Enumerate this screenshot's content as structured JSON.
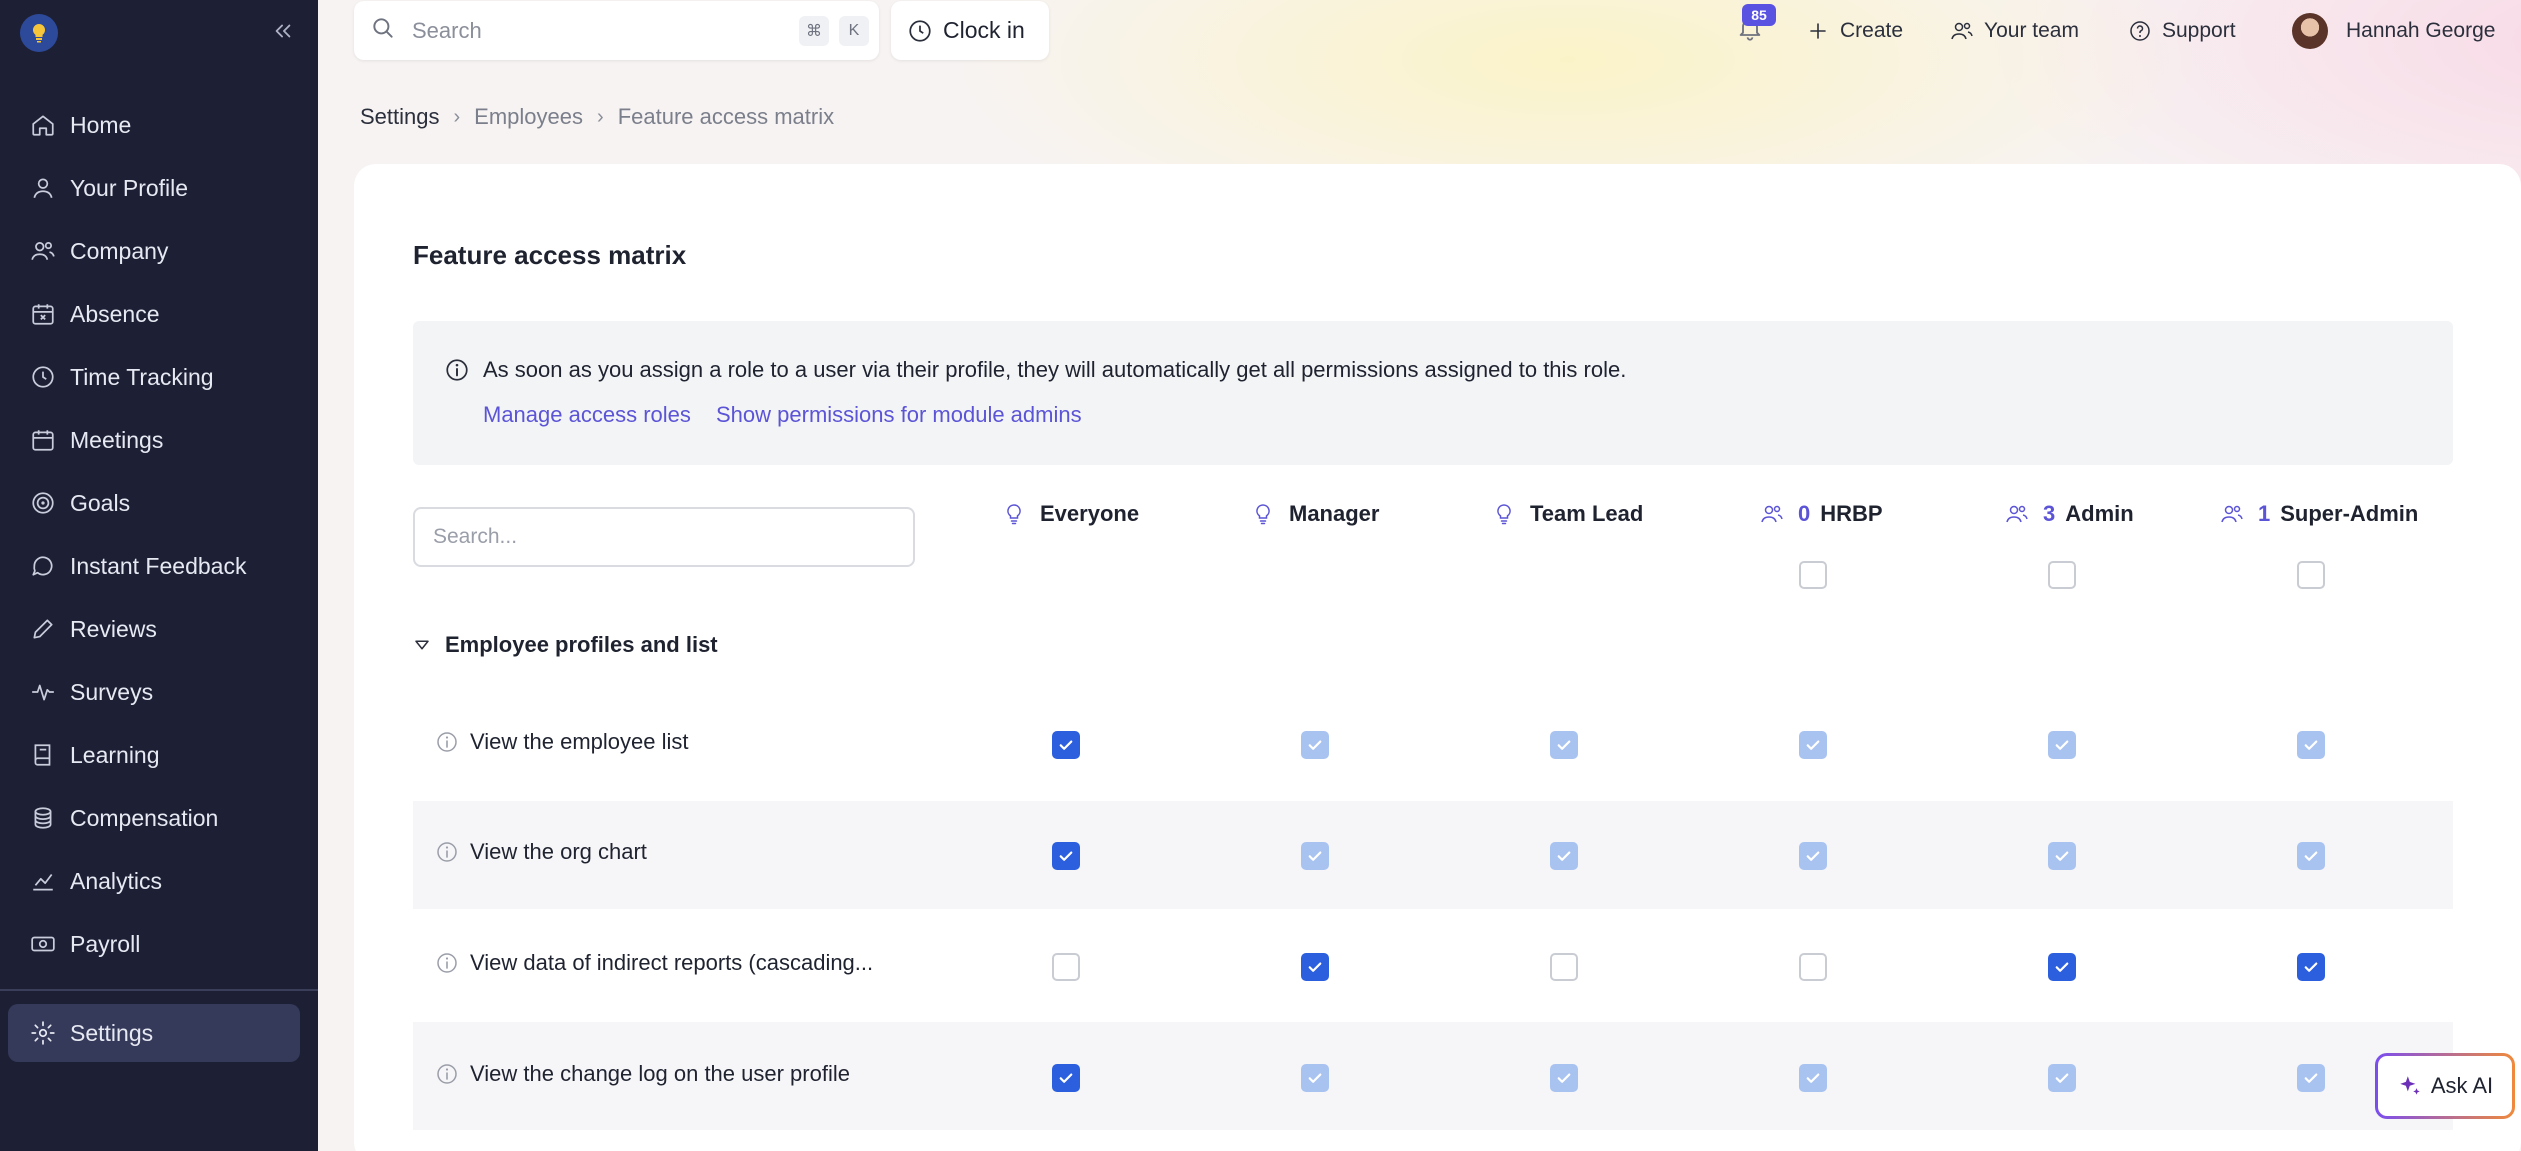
{
  "sidebar": {
    "items": [
      {
        "label": "Home",
        "icon": "home-icon"
      },
      {
        "label": "Your Profile",
        "icon": "user-icon"
      },
      {
        "label": "Company",
        "icon": "people-icon"
      },
      {
        "label": "Absence",
        "icon": "calendar-x-icon"
      },
      {
        "label": "Time Tracking",
        "icon": "clock-icon"
      },
      {
        "label": "Meetings",
        "icon": "calendar-icon"
      },
      {
        "label": "Goals",
        "icon": "target-icon"
      },
      {
        "label": "Instant Feedback",
        "icon": "chat-bubble-icon"
      },
      {
        "label": "Reviews",
        "icon": "pencil-icon"
      },
      {
        "label": "Surveys",
        "icon": "pulse-icon"
      },
      {
        "label": "Learning",
        "icon": "book-icon"
      },
      {
        "label": "Compensation",
        "icon": "coins-icon"
      },
      {
        "label": "Analytics",
        "icon": "chart-icon"
      },
      {
        "label": "Payroll",
        "icon": "banknote-icon"
      }
    ],
    "settings_label": "Settings"
  },
  "topbar": {
    "search_placeholder": "Search",
    "kbd_cmd": "⌘",
    "kbd_k": "K",
    "clock_in_label": "Clock in",
    "notification_count": "85",
    "create_label": "Create",
    "team_label": "Your team",
    "support_label": "Support",
    "user_name": "Hannah George"
  },
  "breadcrumb": {
    "items": [
      "Settings",
      "Employees",
      "Feature access matrix"
    ]
  },
  "page": {
    "title": "Feature access matrix",
    "info_text": "As soon as you assign a role to a user via their profile, they will automatically get all permissions assigned to this role.",
    "link_manage_roles": "Manage access roles",
    "link_show_permissions": "Show permissions for module admins",
    "matrix_search_placeholder": "Search..."
  },
  "columns": [
    {
      "name": "Everyone",
      "count": "",
      "icon": "bulb-icon"
    },
    {
      "name": "Manager",
      "count": "",
      "icon": "bulb-icon"
    },
    {
      "name": "Team Lead",
      "count": "",
      "icon": "bulb-icon"
    },
    {
      "name": "HRBP",
      "count": "0",
      "icon": "users-icon"
    },
    {
      "name": "Admin",
      "count": "3",
      "icon": "users-icon"
    },
    {
      "name": "Super-Admin",
      "count": "1",
      "icon": "users-icon"
    }
  ],
  "section": {
    "title": "Employee profiles and list",
    "rows": [
      {
        "label": "View the employee list",
        "cells": [
          "on",
          "soft",
          "soft",
          "soft",
          "soft",
          "soft"
        ]
      },
      {
        "label": "View the org chart",
        "cells": [
          "on",
          "soft",
          "soft",
          "soft",
          "soft",
          "soft"
        ]
      },
      {
        "label": "View data of indirect reports (cascading...",
        "cells": [
          "empty",
          "on",
          "empty",
          "empty",
          "on",
          "on"
        ]
      },
      {
        "label": "View the change log on the user profile",
        "cells": [
          "on",
          "soft",
          "soft",
          "soft",
          "soft",
          "soft"
        ]
      }
    ]
  },
  "ask_ai_label": "Ask AI",
  "colors": {
    "sidebar_bg": "#1d2035",
    "accent": "#5b54d6",
    "checkbox_on": "#2c5fdd",
    "checkbox_inherited": "#a9c3f1"
  }
}
